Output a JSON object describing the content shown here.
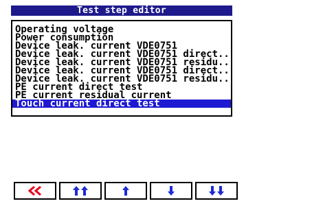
{
  "window": {
    "title": "Test step editor"
  },
  "steps": [
    "Operating voltage",
    "Power consumption",
    "Device leak. current VDE0751",
    "Device leak. current VDE0751 direct..",
    "Device leak. current VDE0751 residu..",
    "Device leak. current VDE0751 direct..",
    "Device leak. current VDE0751 residu..",
    "PE current direct test",
    "PE current residual current",
    "Touch current direct test"
  ],
  "selected_index": 9,
  "toolbar": [
    {
      "icon": "double-chevron-left-icon",
      "color": "#e8001c"
    },
    {
      "icon": "double-arrow-up-icon",
      "color": "#1e2ad2"
    },
    {
      "icon": "arrow-up-icon",
      "color": "#1e2ad2"
    },
    {
      "icon": "arrow-down-icon",
      "color": "#1e2ad2"
    },
    {
      "icon": "double-arrow-down-icon",
      "color": "#1e2ad2"
    }
  ],
  "colors": {
    "titlebar": "#1e1a8c",
    "selection": "#1e1ad2"
  }
}
